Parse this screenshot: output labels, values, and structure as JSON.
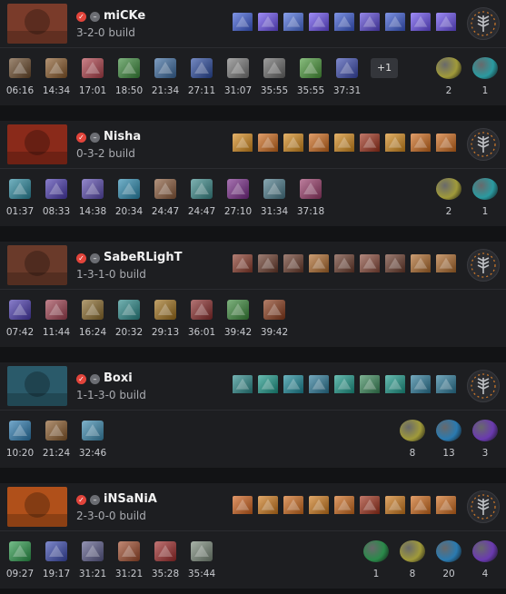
{
  "players": [
    {
      "name": "miCKe",
      "build": "3-2-0 build",
      "portrait_color": "#7a3b2a",
      "skills": [
        "#3b5bd6",
        "#6a4ff0",
        "#4a6ee0",
        "#6a4ff0",
        "#3b5bd6",
        "#5b47d8",
        "#3b5bd6",
        "#6a4ff0",
        "#6a4ff0"
      ],
      "items": [
        {
          "icon": "boots-icon",
          "color": "#6b4a2a",
          "time": "06:16"
        },
        {
          "icon": "axe-icon",
          "color": "#8a5a2a",
          "time": "14:34"
        },
        {
          "icon": "helm-icon",
          "color": "#b0404a",
          "time": "17:01"
        },
        {
          "icon": "blade-icon",
          "color": "#3a8a3a",
          "time": "18:50"
        },
        {
          "icon": "orb-icon",
          "color": "#3a6aa0",
          "time": "21:34"
        },
        {
          "icon": "staff-icon",
          "color": "#2a4aa0",
          "time": "27:11"
        },
        {
          "icon": "hammer-icon",
          "color": "#7a7a7a",
          "time": "31:07"
        },
        {
          "icon": "claw-icon",
          "color": "#6a6a6a",
          "time": "35:55"
        },
        {
          "icon": "leaf-icon",
          "color": "#4a9a3a",
          "time": "35:55"
        },
        {
          "icon": "scepter-icon",
          "color": "#3a4ab0",
          "time": "37:31"
        }
      ],
      "extra": "+1",
      "consumables": [
        {
          "icon": "cheese-icon",
          "color": "#a09a3a",
          "count": "2"
        },
        {
          "icon": "gem-icon",
          "color": "#2a9aa0",
          "count": "1"
        }
      ]
    },
    {
      "name": "Nisha",
      "build": "0-3-2 build",
      "portrait_color": "#8a2a1a",
      "skills": [
        "#d68a1a",
        "#d06a1a",
        "#d68a1a",
        "#d06a1a",
        "#d68a1a",
        "#a0301a",
        "#d68a1a",
        "#d06a1a",
        "#d06a1a"
      ],
      "items": [
        {
          "icon": "orb-icon",
          "color": "#2a8aa0",
          "time": "01:37"
        },
        {
          "icon": "boots-icon",
          "color": "#4a3ab0",
          "time": "08:33"
        },
        {
          "icon": "dagger-icon",
          "color": "#5a4ab0",
          "time": "14:38"
        },
        {
          "icon": "wing-icon",
          "color": "#2a8ab0",
          "time": "20:34"
        },
        {
          "icon": "staff-icon",
          "color": "#8a5a3a",
          "time": "24:47"
        },
        {
          "icon": "crown-icon",
          "color": "#3a8a8a",
          "time": "24:47"
        },
        {
          "icon": "shard-icon",
          "color": "#7a2a8a",
          "time": "27:10"
        },
        {
          "icon": "helm-icon",
          "color": "#4a7a8a",
          "time": "31:34"
        },
        {
          "icon": "rune-icon",
          "color": "#9a3a6a",
          "time": "37:18"
        }
      ],
      "extra": "",
      "consumables": [
        {
          "icon": "cheese-icon",
          "color": "#a09a3a",
          "count": "2"
        },
        {
          "icon": "gem-icon",
          "color": "#2a9aa0",
          "count": "1"
        }
      ]
    },
    {
      "name": "SabeRLighT",
      "build": "1-3-1-0 build",
      "portrait_color": "#6a3a2a",
      "skills": [
        "#8a3a2a",
        "#6a3a2a",
        "#6a3a2a",
        "#b06a2a",
        "#6a3a2a",
        "#8a4a3a",
        "#6a3a2a",
        "#b06a2a",
        "#b06a2a"
      ],
      "items": [
        {
          "icon": "boots-icon",
          "color": "#4a3ab0",
          "time": "07:42"
        },
        {
          "icon": "helm-icon",
          "color": "#a04050",
          "time": "11:44"
        },
        {
          "icon": "axe-icon",
          "color": "#8a6a2a",
          "time": "16:24"
        },
        {
          "icon": "scythe-icon",
          "color": "#2a8a8a",
          "time": "20:32"
        },
        {
          "icon": "claw-icon",
          "color": "#a0701a",
          "time": "29:13"
        },
        {
          "icon": "hammer-icon",
          "color": "#8a2a2a",
          "time": "36:01"
        },
        {
          "icon": "blade-icon",
          "color": "#3a8a3a",
          "time": "39:42"
        },
        {
          "icon": "cross-icon",
          "color": "#8a3a1a",
          "time": "39:42"
        }
      ],
      "extra": "",
      "consumables": []
    },
    {
      "name": "Boxi",
      "build": "1-1-3-0 build",
      "portrait_color": "#2a5a6a",
      "skills": [
        "#2a8a8a",
        "#1a9a8a",
        "#1a8a9a",
        "#2a7a9a",
        "#1a9a8a",
        "#3a8a5a",
        "#1a9a8a",
        "#2a7a9a",
        "#2a7a9a"
      ],
      "items": [
        {
          "icon": "orb-icon",
          "color": "#2a7ab0",
          "time": "10:20"
        },
        {
          "icon": "glaive-icon",
          "color": "#8a5a2a",
          "time": "21:24"
        },
        {
          "icon": "wing-icon",
          "color": "#3a8ab0",
          "time": "32:46"
        }
      ],
      "extra": "",
      "consumables": [
        {
          "icon": "cheese-icon",
          "color": "#a09a3a",
          "count": "8"
        },
        {
          "icon": "gem-icon",
          "color": "#2a7ab0",
          "count": "13"
        },
        {
          "icon": "orb-icon",
          "color": "#6a3ab0",
          "count": "3"
        }
      ]
    },
    {
      "name": "iNSaNiA",
      "build": "2-3-0-0 build",
      "portrait_color": "#b0501a",
      "skills": [
        "#d0601a",
        "#d07a1a",
        "#d06a1a",
        "#d07a1a",
        "#d06a1a",
        "#a0301a",
        "#d07a1a",
        "#d06a1a",
        "#d06a1a"
      ],
      "items": [
        {
          "icon": "boots-icon",
          "color": "#2a9a4a",
          "time": "09:27"
        },
        {
          "icon": "wing-icon",
          "color": "#3a4ab0",
          "time": "19:17"
        },
        {
          "icon": "staff-icon",
          "color": "#5a5a8a",
          "time": "31:21"
        },
        {
          "icon": "claw-icon",
          "color": "#a04a2a",
          "time": "31:21"
        },
        {
          "icon": "hammer-icon",
          "color": "#a02a2a",
          "time": "35:28"
        },
        {
          "icon": "scythe-icon",
          "color": "#7a8a7a",
          "time": "35:44"
        }
      ],
      "extra": "",
      "consumables": [
        {
          "icon": "emerald-icon",
          "color": "#2a8a4a",
          "count": "1"
        },
        {
          "icon": "cheese-icon",
          "color": "#a09a3a",
          "count": "8"
        },
        {
          "icon": "gem-icon",
          "color": "#2a7ab0",
          "count": "20"
        },
        {
          "icon": "orb-icon",
          "color": "#6a3ab0",
          "count": "4"
        }
      ]
    }
  ]
}
